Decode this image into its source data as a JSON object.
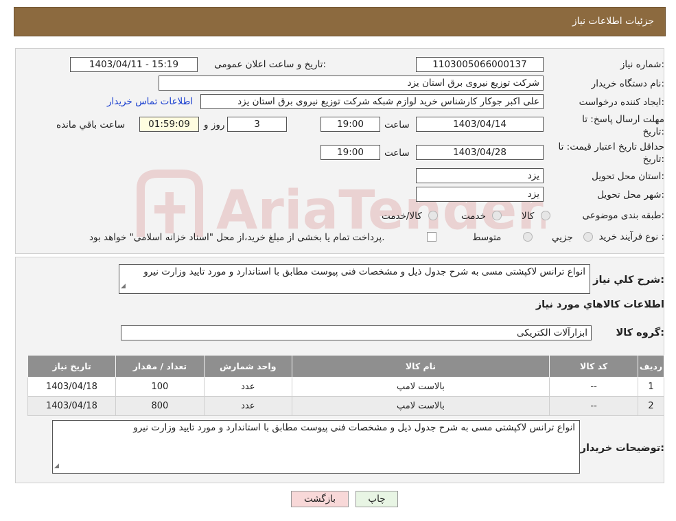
{
  "header": {
    "title": "جزئیات اطلاعات نیاز"
  },
  "form": {
    "need_number_label": "شماره نیاز:",
    "need_number": "1103005066000137",
    "announce_label": "تاریخ و ساعت اعلان عمومی:",
    "announce_value": "1403/04/11 - 15:19",
    "buyer_label": "نام دستگاه خریدار:",
    "buyer_value": "شرکت توزیع نیروی برق استان یزد",
    "creator_label": "ایجاد کننده درخواست:",
    "creator_value": "علی اکبر  جوکار  کارشناس خرید لوازم شبکه  شرکت توزیع نیروی برق استان یزد",
    "contact_link": "اطلاعات تماس خریدار",
    "deadline_label": "مهلت ارسال پاسخ: تا",
    "deadline_label2": "تاریخ:",
    "deadline_date": "1403/04/14",
    "time_word": "ساعت",
    "deadline_time": "19:00",
    "days_value": "3",
    "days_word": "روز و",
    "remaining_time": "01:59:09",
    "remaining_word": "ساعت باقي مانده",
    "validity_label": "حداقل تاریخ اعتبار قیمت: تا",
    "validity_label2": "تاریخ:",
    "validity_date": "1403/04/28",
    "validity_time": "19:00",
    "province_label": "استان محل تحویل:",
    "province_value": "یزد",
    "city_label": "شهر محل تحویل:",
    "city_value": "یزد",
    "category_label": "طبقه بندی موضوعی:",
    "category_options": [
      "کالا",
      "خدمت",
      "کالا/خدمت"
    ],
    "process_label": "نوع فرآیند خرید :",
    "process_options": [
      "جزيي",
      "متوسط"
    ],
    "process_note": "پرداخت تمام یا بخشی از مبلغ خرید،از محل \"اسناد خزانه اسلامی\" خواهد بود."
  },
  "details": {
    "desc_label": "شرح کلي نياز:",
    "desc_value": "انواع ترانس لاکپشتی مسی   به شرح جدول ذیل و مشخصات فنی پیوست مطابق با استاندارد و مورد تایید وزارت نیرو",
    "goods_heading": "اطلاعات کالاهاي مورد نياز",
    "group_label": "گروه کالا:",
    "group_value": "ابزارآلات الکتریکی",
    "table_headers": [
      "رديف",
      "کد کالا",
      "نام کالا",
      "واحد شمارش",
      "تعداد / مقدار",
      "تاريخ نياز"
    ],
    "rows": [
      [
        "1",
        "--",
        "بالاست لامپ",
        "عدد",
        "100",
        "1403/04/18"
      ],
      [
        "2",
        "--",
        "بالاست لامپ",
        "عدد",
        "800",
        "1403/04/18"
      ]
    ],
    "notes_label": "توضیحات خریدار:",
    "notes_value": "انواع ترانس لاکپشتی مسی   به شرح جدول ذیل و مشخصات فنی پیوست مطابق با استاندارد و مورد تایید وزارت نیرو"
  },
  "buttons": {
    "print": "چاپ",
    "back": "بازگشت"
  },
  "watermark": {
    "text": "AriaTender.neT"
  },
  "colors": {
    "header": "#8c6a3f",
    "link": "#1a3fcf",
    "back_button": "#f8d8d8",
    "print_button": "#e8f5e4"
  }
}
